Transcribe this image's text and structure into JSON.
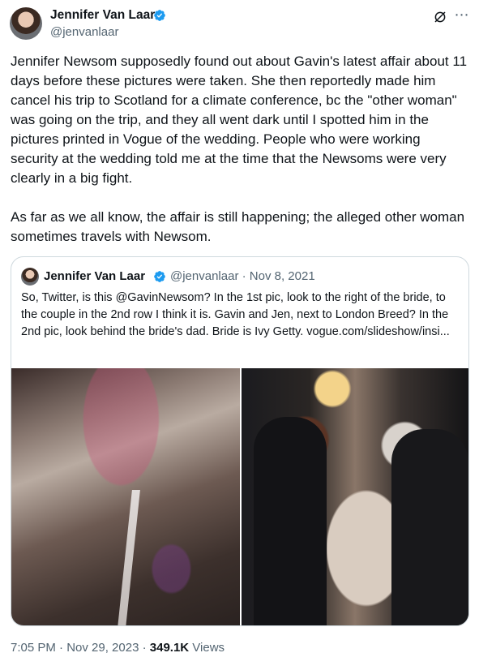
{
  "author": {
    "name": "Jennifer Van Laar",
    "handle": "@jenvanlaar",
    "verified_color": "#1d9bf0"
  },
  "icons": {
    "grok": "grok-icon",
    "more": "more-horizontal-icon",
    "verified": "verified-badge-icon"
  },
  "tweet": {
    "text": "Jennifer Newsom supposedly found out about Gavin's latest affair about 11 days before these pictures were taken. She then reportedly made him cancel his trip to Scotland for a climate conference, bc the \"other woman\" was going on the trip, and they all went dark until I spotted him in the pictures printed in Vogue of the wedding. People who were working security at the wedding told me at the time that the Newsoms were very clearly in a big fight.\n\nAs far as we all know, the affair is still happening; the alleged other woman sometimes travels with Newsom."
  },
  "quote": {
    "name": "Jennifer Van Laar",
    "handle_date": "@jenvanlaar · Nov 8, 2021",
    "text": "So, Twitter, is this @GavinNewsom? In the 1st pic, look to the right of the bride, to the couple in the 2nd row I think it is. Gavin and Jen, next to London Breed? In the 2nd pic, look behind the bride's dad. Bride is Ivy Getty. vogue.com/slideshow/insi..."
  },
  "meta": {
    "timestamp": "7:05 PM · Nov 29, 2023 · ",
    "views_count": "349.1K",
    "views_label": " Views"
  }
}
